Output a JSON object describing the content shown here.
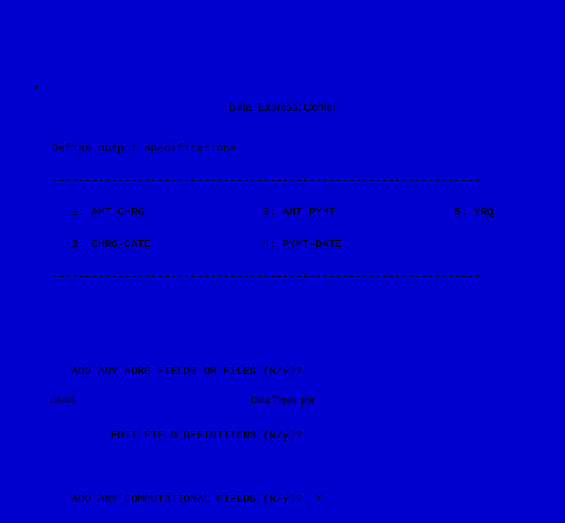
{
  "header": {
    "title": "Data. Express. Center"
  },
  "terminal": {
    "heading": "Define output specifications",
    "rule": "-----------------------------------------------------------------",
    "fields_line1": "   1: AMT-CHRG                  3: AMT-PYMT                  5: YRQ",
    "fields_line2": "   2: CHRG-DATE                 4: PYMT-DATE",
    "prompt1": "   ADD ANY MORE FIELDS OR FILES (N/y)?",
    "prompt2": "         EDIT FIELD DEFINITIONS (N/y)?",
    "prompt3": "   ADD ANY COMPUTATIONAL FIELDS (N/y)?  Y"
  },
  "footer": {
    "date": "1/8/03",
    "filename": "Data Types. ppt"
  }
}
